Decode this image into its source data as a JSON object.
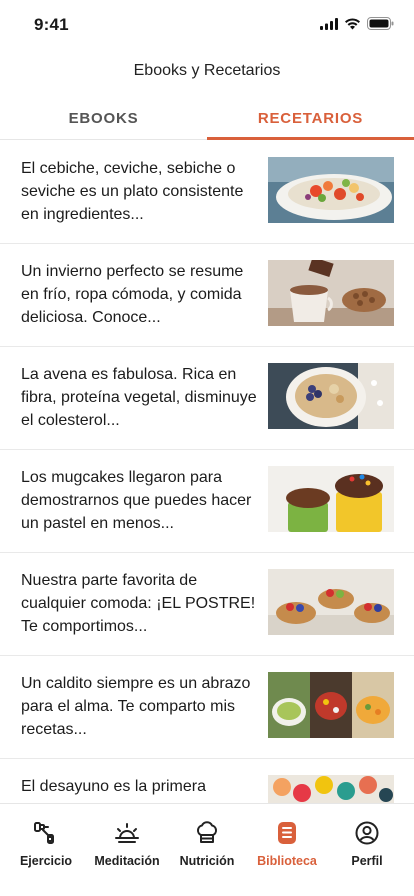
{
  "status_bar": {
    "time": "9:41"
  },
  "header": {
    "title": "Ebooks y Recetarios"
  },
  "tabs": [
    {
      "label": "EBOOKS",
      "active": false
    },
    {
      "label": "RECETARIOS",
      "active": true
    }
  ],
  "items": [
    {
      "text": "El cebiche, ceviche, sebiche o seviche es un plato consistente en ingredientes...",
      "image": "ceviche"
    },
    {
      "text": "Un invierno perfecto se resume en frío, ropa cómoda, y comida deliciosa. Conoce...",
      "image": "hot-chocolate"
    },
    {
      "text": "La avena es fabulosa. Rica en fibra, proteína vegetal, disminuye el colesterol...",
      "image": "oatmeal"
    },
    {
      "text": "Los mugcakes llegaron para demostrarnos que puedes hacer un pastel en menos...",
      "image": "mugcakes"
    },
    {
      "text": "Nuestra parte favorita de cualquier comoda: ¡EL POSTRE! Te comportimos...",
      "image": "fruit-tarts"
    },
    {
      "text": "Un caldito siempre es un abrazo para el alma. Te comparto mis recetas...",
      "image": "soups"
    },
    {
      "text": "El desayuno es la primera",
      "image": "breakfast"
    }
  ],
  "tabbar": [
    {
      "label": "Ejercicio",
      "icon": "dumbbell-icon",
      "active": false
    },
    {
      "label": "Meditación",
      "icon": "sunrise-icon",
      "active": false
    },
    {
      "label": "Nutrición",
      "icon": "chef-hat-icon",
      "active": false
    },
    {
      "label": "Biblioteca",
      "icon": "book-icon",
      "active": true
    },
    {
      "label": "Perfil",
      "icon": "user-icon",
      "active": false
    }
  ],
  "colors": {
    "accent": "#d9603b",
    "text": "#1c1c1c",
    "divider": "#e9e9e9"
  }
}
